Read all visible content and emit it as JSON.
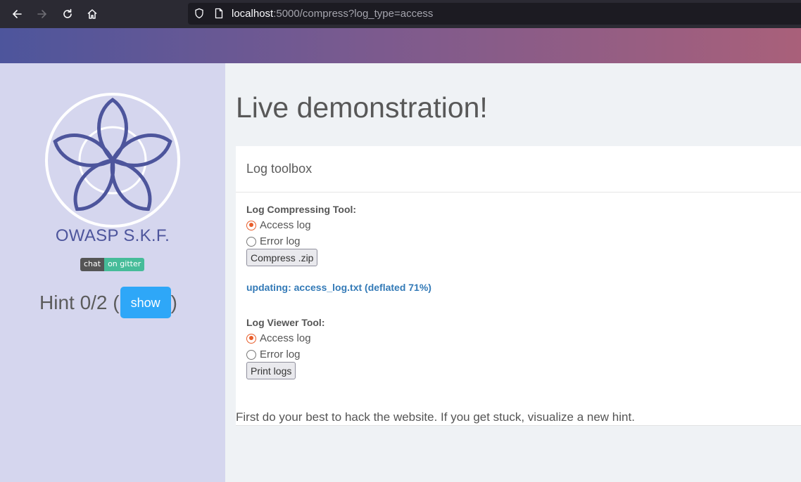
{
  "browser": {
    "url_host": "localhost",
    "url_rest": ":5000/compress?log_type=access"
  },
  "sidebar": {
    "brand": "OWASP S.K.F.",
    "badge_left": "chat",
    "badge_right": "on gitter",
    "hint_prefix": "Hint 0/2 (",
    "hint_suffix": ")",
    "show_label": "show"
  },
  "main": {
    "title": "Live demonstration!",
    "card_title": "Log toolbox",
    "compress": {
      "label": "Log Compressing Tool:",
      "options": [
        {
          "label": "Access log",
          "checked": true
        },
        {
          "label": "Error log",
          "checked": false
        }
      ],
      "button": "Compress .zip"
    },
    "status": "updating: access_log.txt (deflated 71%)",
    "viewer": {
      "label": "Log Viewer Tool:",
      "options": [
        {
          "label": "Access log",
          "checked": true
        },
        {
          "label": "Error log",
          "checked": false
        }
      ],
      "button": "Print logs"
    },
    "footer": "First do your best to hack the website. If you get stuck, visualize a new hint."
  },
  "colors": {
    "accent": "#4d559c",
    "show_button": "#2ea7f8",
    "radio_checked": "#e85d2a",
    "status_text": "#337ab7"
  }
}
